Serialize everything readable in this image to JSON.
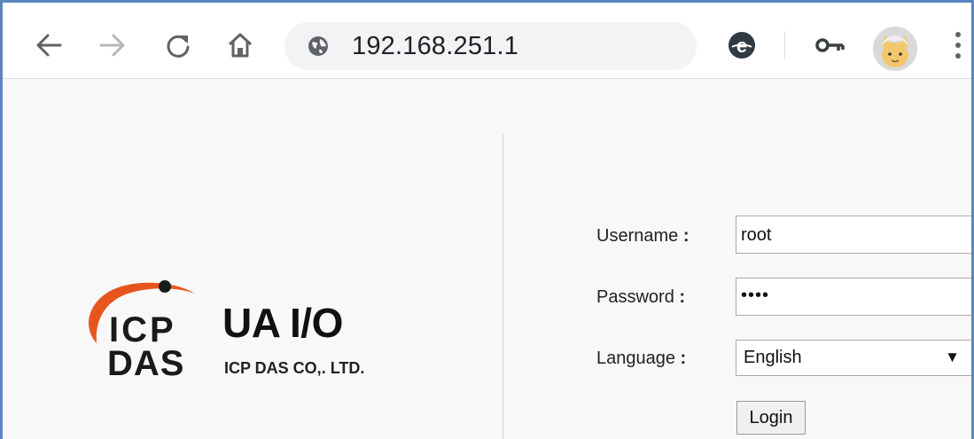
{
  "browser": {
    "url": "192.168.251.1",
    "icons": {
      "back": "back-arrow-icon",
      "forward": "forward-arrow-icon",
      "reload": "reload-icon",
      "home": "home-icon",
      "site_info": "globe-icon",
      "ie_tab": "ie-extension-icon",
      "passwords": "key-icon",
      "profile": "profile-avatar",
      "menu": "kebab-menu-icon"
    }
  },
  "brand": {
    "logo_line1": "ICP",
    "logo_line2": "DAS",
    "title": "UA I/O",
    "company": "ICP DAS CO,. LTD."
  },
  "login": {
    "username_label": "Username",
    "password_label": "Password",
    "language_label": "Language",
    "separator": ":",
    "username_value": "root",
    "password_value": "••••",
    "language_value": "English",
    "select_arrow": "▼",
    "login_button": "Login"
  },
  "colors": {
    "logo_orange": "#e8541e",
    "frame_border": "#5a85c0",
    "omnibox_bg": "#f1f3f4"
  }
}
